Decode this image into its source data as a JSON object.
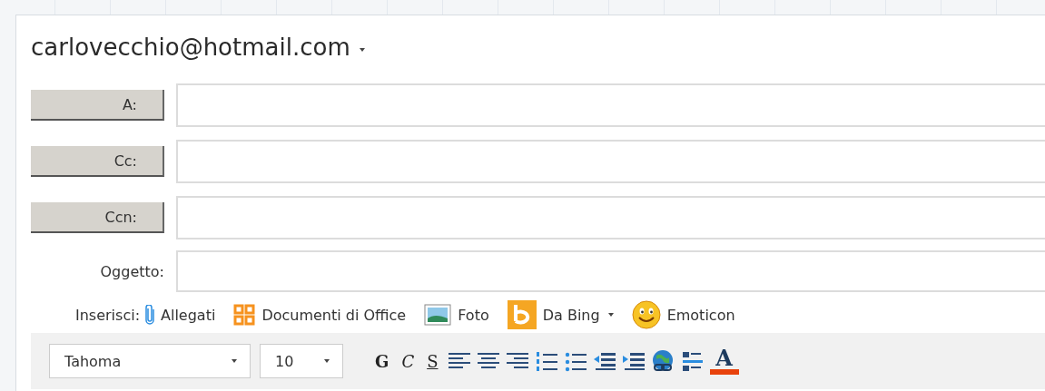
{
  "account": {
    "address": "carlovecchio@hotmail.com",
    "dropdown": true
  },
  "recipients": [
    {
      "label": "A:",
      "kind": "button"
    },
    {
      "label": "Cc:",
      "kind": "button"
    },
    {
      "label": "Ccn:",
      "kind": "button"
    },
    {
      "label": "Oggetto:",
      "kind": "label"
    }
  ],
  "insert": {
    "label": "Inserisci:",
    "items": [
      {
        "kind": "attachment",
        "label": "Allegati",
        "dropdown": false
      },
      {
        "kind": "office",
        "label": "Documenti di Office",
        "dropdown": false
      },
      {
        "kind": "photo",
        "label": "Foto",
        "dropdown": false
      },
      {
        "kind": "bing",
        "label": "Da Bing",
        "dropdown": true
      },
      {
        "kind": "emoticon",
        "label": "Emoticon",
        "dropdown": false
      }
    ]
  },
  "toolbar": {
    "font": "Tahoma",
    "size": "10",
    "styles": [
      {
        "kind": "bold",
        "label": "G"
      },
      {
        "kind": "italic",
        "label": "C"
      },
      {
        "kind": "underline",
        "label": "S"
      }
    ],
    "tools": [
      {
        "kind": "align-left"
      },
      {
        "kind": "align-center"
      },
      {
        "kind": "align-right"
      },
      {
        "kind": "numbered-list"
      },
      {
        "kind": "bullet-list"
      },
      {
        "kind": "outdent"
      },
      {
        "kind": "indent"
      },
      {
        "kind": "link"
      },
      {
        "kind": "spacing"
      }
    ],
    "font_color": {
      "label": "A",
      "color": "#e8420c"
    }
  }
}
